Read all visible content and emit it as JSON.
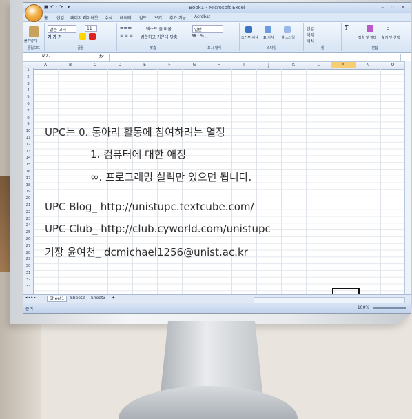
{
  "window": {
    "title": "Book1 - Microsoft Excel",
    "controls": "– ▫ ×"
  },
  "quick_access": "▣ ↶ · ↷ · ▾",
  "menu": {
    "tabs": [
      "홈",
      "삽입",
      "페이지 레이아웃",
      "수식",
      "데이터",
      "검토",
      "보기",
      "추가 기능",
      "Acrobat"
    ]
  },
  "ribbon": {
    "clipboard": {
      "paste": "붙여넣기",
      "label": "클립보드"
    },
    "font": {
      "name": "맑은 고딕",
      "size": "11",
      "label": "글꼴"
    },
    "alignment": {
      "wrap": "텍스트 줄 바꿈",
      "merge": "병합하고 가운데 맞춤",
      "label": "맞춤"
    },
    "number": {
      "format": "일반",
      "label": "표시 형식"
    },
    "styles": {
      "cond": "조건부 서식",
      "table": "표 서식",
      "cell": "셀 스타일",
      "label": "스타일"
    },
    "cells": {
      "insert": "삽입",
      "delete": "삭제",
      "format": "서식",
      "label": "셀"
    },
    "editing": {
      "sort": "정렬 및 필터",
      "find": "찾기 및 선택",
      "label": "편집"
    }
  },
  "formula_bar": {
    "name_box": "M27",
    "fx": "fx",
    "value": ""
  },
  "columns": [
    "A",
    "B",
    "C",
    "D",
    "E",
    "F",
    "G",
    "H",
    "I",
    "J",
    "K",
    "L",
    "M",
    "N",
    "O"
  ],
  "selected_column": "M",
  "rows": [
    "1",
    "2",
    "3",
    "4",
    "5",
    "6",
    "7",
    "8",
    "9",
    "10",
    "11",
    "12",
    "13",
    "14",
    "15",
    "16",
    "17",
    "18",
    "19",
    "20",
    "21",
    "22",
    "23",
    "24",
    "25",
    "26",
    "27",
    "28",
    "29",
    "30",
    "31",
    "32",
    "33"
  ],
  "content": {
    "line1": "UPC는 0. 동아리 활동에 참여하려는 열정",
    "line2": "1. 컴퓨터에 대한 애정",
    "line3": "∞. 프로그래밍 실력만 있으면 됩니다.",
    "line4": "UPC Blog_ http://unistupc.textcube.com/",
    "line5": "UPC Club_ http://club.cyworld.com/unistupc",
    "line6": "기장 윤여천_ dcmichael1256@unist.ac.kr"
  },
  "sheets": [
    "Sheet1",
    "Sheet2",
    "Sheet3"
  ],
  "sheet_nav": "◂ ◂ ▸ ▸",
  "status": {
    "ready": "준비",
    "zoom": "100%"
  },
  "colors": {
    "ribbon_bg": "#d7e4f4",
    "selected_header": "#f7cf72",
    "office_button": "#f3b34a"
  }
}
